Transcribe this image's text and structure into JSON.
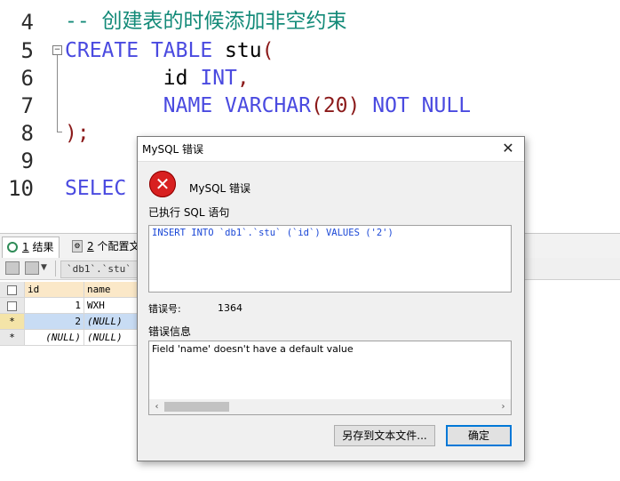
{
  "editor": {
    "line_numbers": [
      "4",
      "5",
      "6",
      "7",
      "8",
      "9",
      "10"
    ],
    "line4": {
      "comment": "-- 创建表的时候添加非空约束"
    },
    "line5": {
      "kw1": "CREATE",
      "kw2": "TABLE",
      "ident": " stu",
      "paren": "("
    },
    "line6": {
      "ident": "id",
      "type": "INT",
      "punct": ","
    },
    "line7": {
      "col": "NAME",
      "type": "VARCHAR",
      "paren_open": "(",
      "num": "20",
      "paren_close": ")",
      "kw1": "NOT",
      "kw2": "NULL"
    },
    "line8": {
      "punct": ");"
    },
    "line10": {
      "kw": "SELEC"
    }
  },
  "results": {
    "tabs": [
      {
        "num": "1",
        "label": "结果"
      },
      {
        "num": "2",
        "label": "个配置文"
      }
    ],
    "toolbar": {
      "table_name": "`db1`.`stu`"
    },
    "columns": [
      "id",
      "name"
    ],
    "rows": [
      {
        "marker": "",
        "id": "1",
        "name": "WXH"
      },
      {
        "marker": "*",
        "id": "2",
        "name": "(NULL)"
      },
      {
        "marker": "*",
        "id": "(NULL)",
        "name": "(NULL)"
      }
    ]
  },
  "dialog": {
    "title": "MySQL 错误",
    "close": "✕",
    "heading": "MySQL 错误",
    "sql_label": "已执行 SQL 语句",
    "sql_text": "INSERT INTO `db1`.`stu` (`id`) VALUES ('2')",
    "code_label": "错误号:",
    "code_value": "1364",
    "info_label": "错误信息",
    "info_text": "Field 'name' doesn't have a default value",
    "save_button": "另存到文本文件...",
    "ok_button": "确定",
    "colors": {
      "sql_text": "#1a47d6",
      "error_icon": "#d82020",
      "ok_border": "#0078d7"
    }
  }
}
